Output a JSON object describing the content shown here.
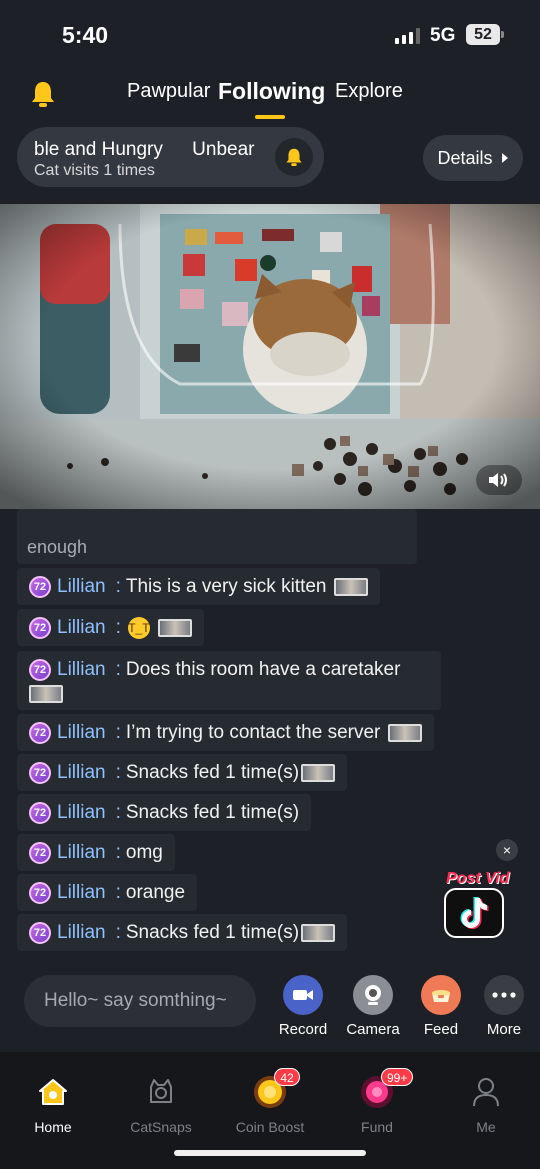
{
  "status_bar": {
    "time": "5:40",
    "network": "5G",
    "battery": "52"
  },
  "nav": {
    "tabs": [
      {
        "label": "Pawpular"
      },
      {
        "label": "Following"
      },
      {
        "label": "Explore"
      }
    ],
    "active_tab": "Following"
  },
  "room": {
    "name": "ble and Hungry",
    "action": "Unbear",
    "visits": "Cat visits 1 times",
    "details_label": "Details"
  },
  "chat": {
    "partial_text": "enough",
    "messages": [
      {
        "badge": "72",
        "user": "Lillian",
        "colon": ":",
        "text": "This is a very sick kitten"
      },
      {
        "badge": "72",
        "user": "Lillian",
        "colon": ":",
        "text": ""
      },
      {
        "badge": "72",
        "user": "Lillian",
        "colon": ":",
        "text": "Does this room have a caretaker"
      },
      {
        "badge": "72",
        "user": "Lillian",
        "colon": ":",
        "text": "I’m trying to contact the server"
      },
      {
        "badge": "72",
        "user": "Lillian",
        "colon": ":",
        "text": "Snacks fed 1 time(s)"
      },
      {
        "badge": "72",
        "user": "Lillian",
        "colon": ":",
        "text": "Snacks fed 1 time(s)"
      },
      {
        "badge": "72",
        "user": "Lillian",
        "colon": ":",
        "text": "omg"
      },
      {
        "badge": "72",
        "user": "Lillian",
        "colon": ":",
        "text": "orange"
      },
      {
        "badge": "72",
        "user": "Lillian",
        "colon": ":",
        "text": "Snacks fed 1 time(s)"
      }
    ]
  },
  "post_vid": {
    "label": "Post Vid",
    "close": "×"
  },
  "composer": {
    "placeholder": "Hello~ say somthing~"
  },
  "actions": [
    {
      "label": "Record",
      "icon": "video-camera-icon",
      "color": "#4a63c9"
    },
    {
      "label": "Camera",
      "icon": "webcam-icon",
      "color": "#8b8e94"
    },
    {
      "label": "Feed",
      "icon": "food-bowl-icon",
      "color": "#f07a55"
    },
    {
      "label": "More",
      "icon": "more-dots-icon",
      "color": "#3a3d44"
    }
  ],
  "tabbar": {
    "items": [
      {
        "label": "Home",
        "icon": "home-icon",
        "badge": ""
      },
      {
        "label": "CatSnaps",
        "icon": "catsnaps-icon",
        "badge": ""
      },
      {
        "label": "Coin Boost",
        "icon": "coin-icon",
        "badge": "42"
      },
      {
        "label": "Fund",
        "icon": "fund-icon",
        "badge": "99+"
      },
      {
        "label": "Me",
        "icon": "person-icon",
        "badge": ""
      }
    ],
    "active": "Home"
  },
  "colors": {
    "accent": "#ffc61a",
    "background": "#1d2026",
    "username": "#8fc0ff",
    "badge_red": "#ff3b46"
  }
}
